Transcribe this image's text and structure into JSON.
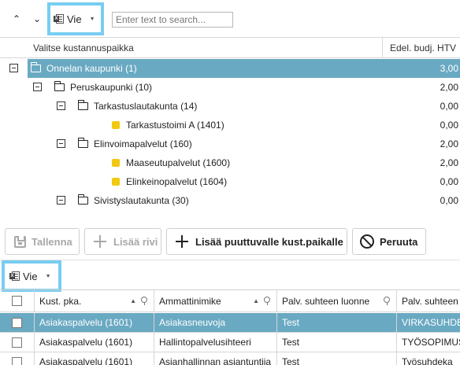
{
  "toolbar": {
    "up_icon": "chevron-up-icon",
    "down_icon": "chevron-down-icon",
    "export_label": "Vie",
    "export_icon": "excel-icon",
    "search_placeholder": "Enter text to search..."
  },
  "highlight_color": "#78cdf1",
  "selection_color": "#6aa9c2",
  "leaf_color": "#f2c811",
  "tree": {
    "columns": [
      "Valitse kustannuspaikka",
      "Edel. budj. HTV"
    ],
    "rows": [
      {
        "label": "Onnelan kaupunki (1)",
        "value": "3,00",
        "level": 0,
        "type": "folder",
        "expanded": true,
        "selected": true
      },
      {
        "label": "Peruskaupunki (10)",
        "value": "2,00",
        "level": 1,
        "type": "folder",
        "expanded": true,
        "selected": false
      },
      {
        "label": "Tarkastuslautakunta (14)",
        "value": "0,00",
        "level": 2,
        "type": "folder",
        "expanded": true,
        "selected": false
      },
      {
        "label": "Tarkastustoimi A (1401)",
        "value": "0,00",
        "level": 3,
        "type": "leaf",
        "selected": false
      },
      {
        "label": "Elinvoimapalvelut (160)",
        "value": "2,00",
        "level": 2,
        "type": "folder",
        "expanded": true,
        "selected": false
      },
      {
        "label": "Maaseutupalvelut (1600)",
        "value": "2,00",
        "level": 3,
        "type": "leaf",
        "selected": false
      },
      {
        "label": "Elinkeinopalvelut (1604)",
        "value": "0,00",
        "level": 3,
        "type": "leaf",
        "selected": false
      },
      {
        "label": "Sivistyslautakunta (30)",
        "value": "0,00",
        "level": 2,
        "type": "folder",
        "expanded": true,
        "selected": false
      }
    ]
  },
  "actions": {
    "save": "Tallenna",
    "add_row": "Lisää rivi",
    "add_missing": "Lisää puuttuvalle kust.paikalle",
    "cancel": "Peruuta"
  },
  "bottom_toolbar": {
    "export_label": "Vie"
  },
  "grid": {
    "columns": [
      "Kust. pka.",
      "Ammattinimike",
      "Palv. suhteen luonne",
      "Palv. suhteen"
    ],
    "rows": [
      {
        "cells": [
          "Asiakaspalvelu (1601)",
          "Asiakasneuvoja",
          "Test",
          "VIRKASUHDE"
        ],
        "selected": true
      },
      {
        "cells": [
          "Asiakaspalvelu (1601)",
          "Hallintopalvelusihteeri",
          "Test",
          "TYÖSOPIMUS"
        ],
        "selected": false
      },
      {
        "cells": [
          "Asiakaspalvelu (1601)",
          "Asianhallinnan asiantuntija",
          "Test",
          "Työsuhdeka"
        ],
        "selected": false
      }
    ]
  }
}
